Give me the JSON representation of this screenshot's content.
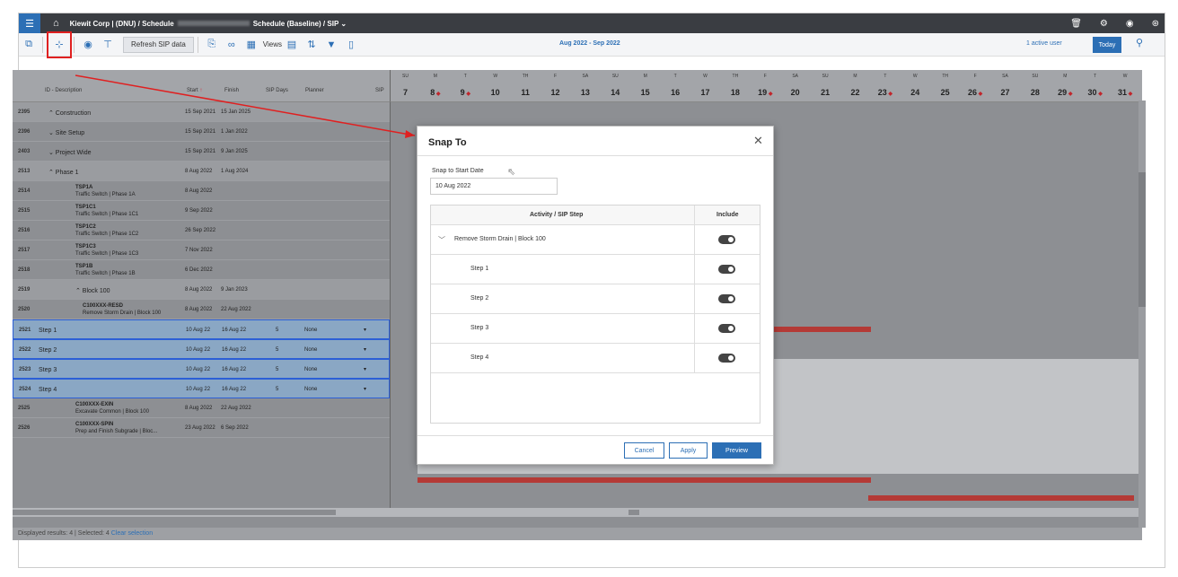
{
  "topbar": {
    "breadcrumb_prefix": "Kiewit Corp | (DNU) / Schedule",
    "breadcrumb_suffix": "Schedule (Baseline) / SIP ⌄"
  },
  "toolbar": {
    "refresh_label": "Refresh SIP data",
    "views_label": "Views",
    "date_range": "Aug 2022 - Sep 2022",
    "active_users": "1 active user",
    "today_label": "Today"
  },
  "grid": {
    "headers": {
      "id_desc": "ID - Description",
      "start": "Start",
      "finish": "Finish",
      "sip_days": "SIP Days",
      "planner": "Planner",
      "sip": "SIP"
    },
    "rows": [
      {
        "id": "2395",
        "desc": "⌃ Construction",
        "start": "15 Sep 2021",
        "finish": "15 Jan 2025"
      },
      {
        "id": "2396",
        "desc": "⌄ Site Setup",
        "start": "15 Sep 2021",
        "finish": "1 Jan 2022"
      },
      {
        "id": "2403",
        "desc": "⌄ Project Wide",
        "start": "15 Sep 2021",
        "finish": "9 Jan 2025"
      },
      {
        "id": "2513",
        "desc": "⌃ Phase 1",
        "start": "8 Aug 2022",
        "finish": "1 Aug 2024"
      },
      {
        "id": "2514",
        "code": "TSP1A",
        "desc": "Traffic Switch | Phase 1A",
        "start": "8 Aug 2022"
      },
      {
        "id": "2515",
        "code": "TSP1C1",
        "desc": "Traffic Switch | Phase 1C1",
        "start": "9 Sep 2022"
      },
      {
        "id": "2516",
        "code": "TSP1C2",
        "desc": "Traffic Switch | Phase 1C2",
        "start": "26 Sep 2022"
      },
      {
        "id": "2517",
        "code": "TSP1C3",
        "desc": "Traffic Switch | Phase 1C3",
        "start": "7 Nov 2022"
      },
      {
        "id": "2518",
        "code": "TSP1B",
        "desc": "Traffic Switch | Phase 1B",
        "start": "6 Dec 2022"
      },
      {
        "id": "2519",
        "desc": "⌃ Block 100",
        "start": "8 Aug 2022",
        "finish": "9 Jan 2023"
      },
      {
        "id": "2520",
        "code": "C100XXX-RESD",
        "desc": "Remove Storm Drain | Block 100",
        "start": "8 Aug 2022",
        "finish": "22 Aug 2022"
      },
      {
        "id": "2521",
        "desc": "Step 1",
        "start": "10 Aug 22",
        "finish": "16 Aug 22",
        "days": "5",
        "planner": "None"
      },
      {
        "id": "2522",
        "desc": "Step 2",
        "start": "10 Aug 22",
        "finish": "16 Aug 22",
        "days": "5",
        "planner": "None"
      },
      {
        "id": "2523",
        "desc": "Step 3",
        "start": "10 Aug 22",
        "finish": "16 Aug 22",
        "days": "5",
        "planner": "None"
      },
      {
        "id": "2524",
        "desc": "Step 4",
        "start": "10 Aug 22",
        "finish": "16 Aug 22",
        "days": "5",
        "planner": "None"
      },
      {
        "id": "2525",
        "code": "C100XXX-EXIN",
        "desc": "Excavate Common | Block 100",
        "start": "8 Aug 2022",
        "finish": "22 Aug 2022"
      },
      {
        "id": "2526",
        "code": "C100XXX-SPIN",
        "desc": "Prep and Finish Subgrade | Bloc...",
        "start": "23 Aug 2022",
        "finish": "6 Sep 2022"
      }
    ],
    "days": [
      {
        "dn": "SU",
        "d": "7"
      },
      {
        "dn": "M",
        "d": "8",
        "m": true
      },
      {
        "dn": "T",
        "d": "9",
        "m": true
      },
      {
        "dn": "W",
        "d": "10"
      },
      {
        "dn": "TH",
        "d": "11"
      },
      {
        "dn": "F",
        "d": "12"
      },
      {
        "dn": "SA",
        "d": "13"
      },
      {
        "dn": "SU",
        "d": "14"
      },
      {
        "dn": "M",
        "d": "15"
      },
      {
        "dn": "T",
        "d": "16"
      },
      {
        "dn": "W",
        "d": "17"
      },
      {
        "dn": "TH",
        "d": "18"
      },
      {
        "dn": "F",
        "d": "19",
        "m": true
      },
      {
        "dn": "SA",
        "d": "20"
      },
      {
        "dn": "SU",
        "d": "21"
      },
      {
        "dn": "M",
        "d": "22"
      },
      {
        "dn": "T",
        "d": "23",
        "m": true
      },
      {
        "dn": "W",
        "d": "24"
      },
      {
        "dn": "TH",
        "d": "25"
      },
      {
        "dn": "F",
        "d": "26",
        "m": true
      },
      {
        "dn": "SA",
        "d": "27"
      },
      {
        "dn": "SU",
        "d": "28"
      },
      {
        "dn": "M",
        "d": "29",
        "m": true
      },
      {
        "dn": "T",
        "d": "30",
        "m": true
      },
      {
        "dn": "W",
        "d": "31",
        "m": true
      }
    ]
  },
  "footer": {
    "text": "Displayed results: 4  |  Selected: 4",
    "clear": "Clear selection"
  },
  "dialog": {
    "title": "Snap To",
    "snap_label": "Snap to Start Date",
    "snap_value": "10 Aug 2022",
    "col_activity": "Activity / SIP Step",
    "col_include": "Include",
    "parent": "Remove Storm Drain | Block 100",
    "steps": [
      "Step 1",
      "Step 2",
      "Step 3",
      "Step 4"
    ],
    "cancel": "Cancel",
    "apply": "Apply",
    "preview": "Preview"
  }
}
